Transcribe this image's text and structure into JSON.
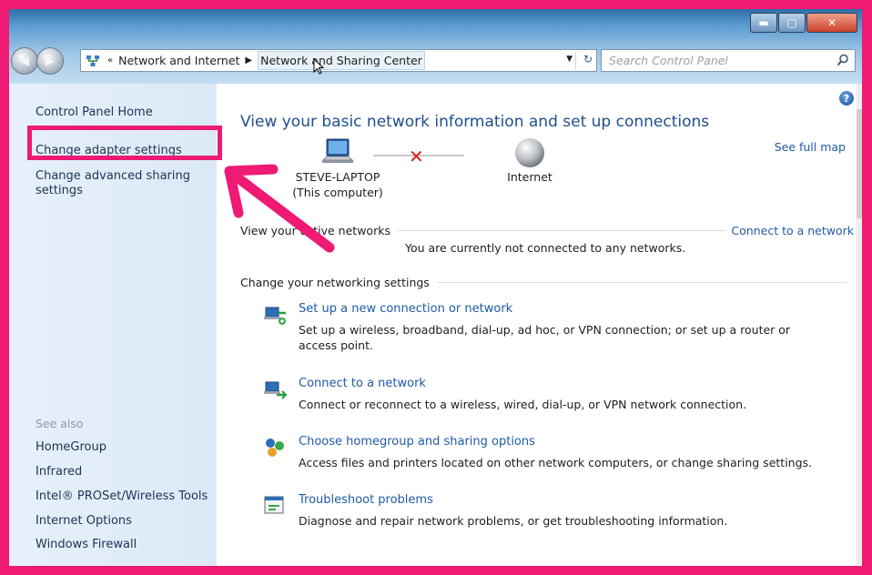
{
  "window": {
    "minimize": "▬",
    "maximize": "▢",
    "close": "✕"
  },
  "nav": {
    "back": "◀",
    "forward": "▶"
  },
  "address": {
    "lead": "«",
    "crumbs": [
      "Network and Internet",
      "Network and Sharing Center"
    ],
    "separator": "▶",
    "dropdown": "▼",
    "refresh": "↻"
  },
  "search": {
    "placeholder": "Search Control Panel"
  },
  "sidebar": {
    "home": "Control Panel Home",
    "change_adapter": "Change adapter settings",
    "change_advanced": "Change advanced sharing settings",
    "see_also_label": "See also",
    "see_also": [
      "HomeGroup",
      "Infrared",
      "Intel® PROSet/Wireless Tools",
      "Internet Options",
      "Windows Firewall"
    ]
  },
  "main": {
    "help": "?",
    "title": "View your basic network information and set up connections",
    "see_full_map": "See full map",
    "computer_name": "STEVE-LAPTOP",
    "computer_sub": "(This computer)",
    "internet_label": "Internet",
    "x_mark": "✕",
    "active_networks_label": "View your active networks",
    "connect_link": "Connect to a network",
    "not_connected": "You are currently not connected to any networks.",
    "change_settings_label": "Change your networking settings",
    "tasks": [
      {
        "title": "Set up a new connection or network",
        "desc": "Set up a wireless, broadband, dial-up, ad hoc, or VPN connection; or set up a router or access point."
      },
      {
        "title": "Connect to a network",
        "desc": "Connect or reconnect to a wireless, wired, dial-up, or VPN network connection."
      },
      {
        "title": "Choose homegroup and sharing options",
        "desc": "Access files and printers located on other network computers, or change sharing settings."
      },
      {
        "title": "Troubleshoot problems",
        "desc": "Diagnose and repair network problems, or get troubleshooting information."
      }
    ]
  },
  "colors": {
    "highlight": "#ee1a74",
    "link": "#1f5ba8",
    "title": "#1e4f8c"
  }
}
